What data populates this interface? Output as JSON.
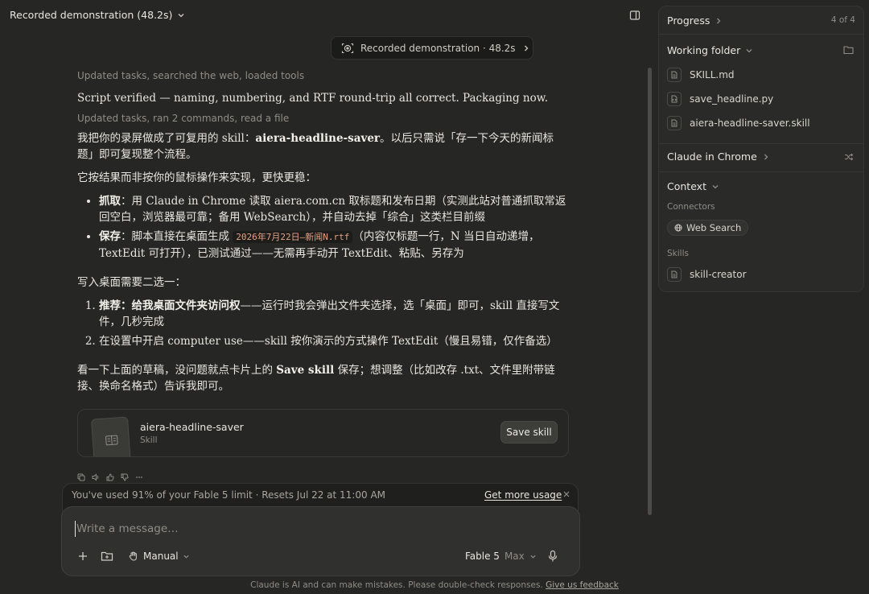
{
  "header": {
    "title": "Recorded demonstration (48.2s)"
  },
  "recording_pill": {
    "label": "Recorded demonstration · 48.2s"
  },
  "chat": {
    "status_1": "Updated tasks, searched the web, loaded tools",
    "line_verified": "Script verified — naming, numbering, and RTF round-trip all correct. Packaging now.",
    "status_2": "Updated tasks, ran 2 commands, read a file",
    "para1_a": "我把你的录屏做成了可复用的 skill：",
    "para1_b": "aiera-headline-saver",
    "para1_c": "。以后只需说「存一下今天的新闻标题」即可复现整个流程。",
    "para2": "它按结果而非按你的鼠标操作来实现，更快更稳：",
    "bullet1_label": "抓取",
    "bullet1_text": "：用 Claude in Chrome 读取 aiera.com.cn 取标题和发布日期（实测此站对普通抓取常返回空白，浏览器最可靠；备用 WebSearch），并自动去掉「综合」这类栏目前缀",
    "bullet2_label": "保存",
    "bullet2_text_a": "：脚本直接在桌面生成 ",
    "bullet2_code": "2026年7月22日—新闻N.rtf",
    "bullet2_text_b": "（内容仅标题一行，N 当日自动递增，TextEdit 可打开），已测试通过——无需再手动开 TextEdit、粘贴、另存为",
    "para3": "写入桌面需要二选一：",
    "ol1_label": "推荐：给我桌面文件夹访问权",
    "ol1_text": "——运行时我会弹出文件夹选择，选「桌面」即可，skill 直接写文件，几秒完成",
    "ol2_text": "在设置中开启 computer use——skill 按你演示的方式操作 TextEdit（慢且易错，仅作备选）",
    "para4_a": "看一下上面的草稿，没问题就点卡片上的 ",
    "para4_b": "Save skill",
    "para4_c": " 保存；想调整（比如改存 .txt、文件里附带链接、换命名格式）告诉我即可。"
  },
  "skill_card": {
    "name": "aiera-headline-saver",
    "kind": "Skill",
    "button": "Save skill"
  },
  "message_actions": [
    "copy-icon",
    "speaker-icon",
    "thumbs-up-icon",
    "thumbs-down-icon",
    "more-icon"
  ],
  "usage": {
    "message": "You've used 91% of your Fable 5 limit · Resets Jul 22 at 11:00 AM",
    "link": "Get more usage"
  },
  "composer": {
    "placeholder": "Write a message…",
    "mode": "Manual",
    "model": "Fable 5",
    "effort": "Max"
  },
  "disclaimer": {
    "text": "Claude is AI and can make mistakes. Please double-check responses.",
    "link": "Give us feedback"
  },
  "panel": {
    "progress": {
      "label": "Progress",
      "count": "4 of 4"
    },
    "working_folder": {
      "label": "Working folder",
      "files": [
        "SKILL.md",
        "save_headline.py",
        "aiera-headline-saver.skill"
      ]
    },
    "chrome": {
      "label": "Claude in Chrome"
    },
    "context": {
      "label": "Context",
      "connectors_label": "Connectors",
      "connector": "Web Search",
      "skills_label": "Skills",
      "skill": "skill-creator"
    }
  },
  "colors": {
    "background": "#262624",
    "panel": "#2a2a28",
    "code_accent": "#e6a184",
    "text": "#e8e6df",
    "muted": "#8f8d86"
  }
}
